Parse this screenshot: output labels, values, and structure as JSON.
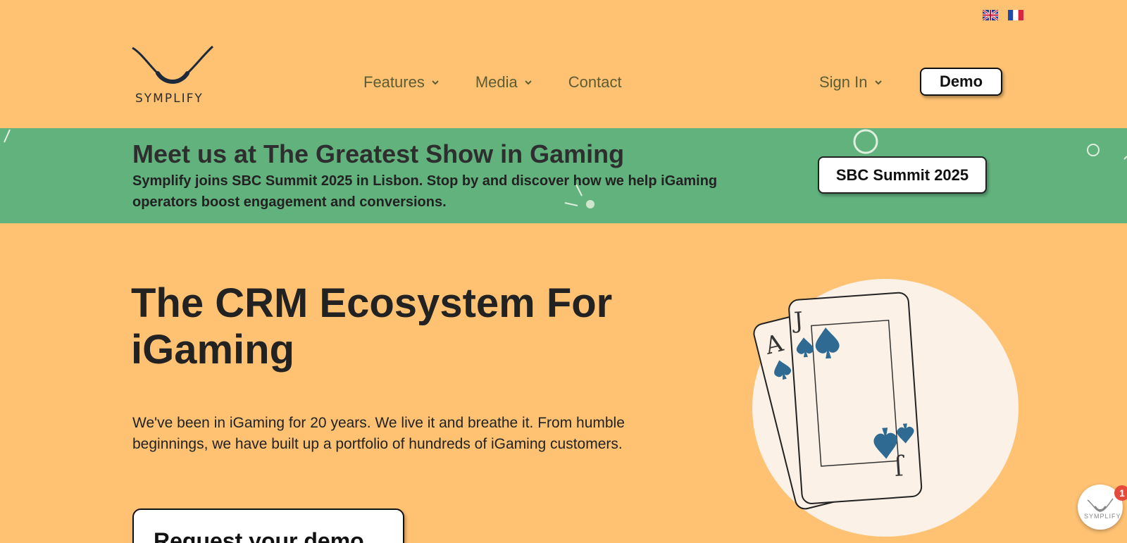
{
  "header": {
    "languages": [
      {
        "name": "english",
        "icon": "uk-flag-icon"
      },
      {
        "name": "french",
        "icon": "france-flag-icon"
      }
    ],
    "logo_text": "SYMPLIFY",
    "nav": [
      {
        "label": "Features",
        "dropdown": true
      },
      {
        "label": "Media",
        "dropdown": true
      },
      {
        "label": "Contact",
        "dropdown": false
      }
    ],
    "sign_in_label": "Sign In",
    "demo_label": "Demo"
  },
  "banner": {
    "title": "Meet us at The Greatest Show in Gaming",
    "text": "Symplify joins SBC Summit 2025 in Lisbon. Stop by and discover how we help iGaming operators boost engagement and conversions.",
    "button_label": "SBC Summit 2025",
    "background_color": "#62b27e"
  },
  "hero": {
    "title": "The CRM Ecosystem For iGaming",
    "text": "We've been in iGaming for 20 years. We live it and breathe it. From humble beginnings, we have built up a portfolio of hundreds of iGaming customers.",
    "button_label": "Request your demo",
    "illustration": "playing-cards-ace-jack-spades"
  },
  "chat_widget": {
    "badge_count": "1",
    "label": "SYMPLIFY"
  },
  "colors": {
    "page_background": "#ffc273",
    "nav_text": "#5c5c33",
    "spade": "#2f6a93"
  }
}
